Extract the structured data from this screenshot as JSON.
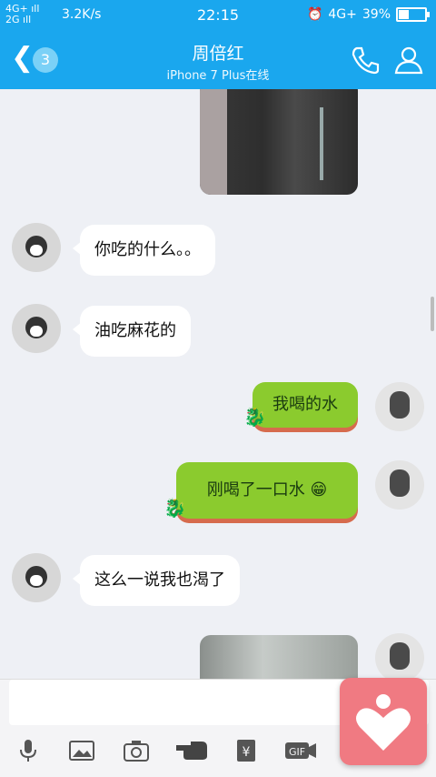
{
  "status_bar": {
    "signal_top": "4G+",
    "signal_bottom": "2G",
    "net_speed": "3.2K/s",
    "time": "22:15",
    "network": "4G+",
    "battery_percent": "39%",
    "battery_level": 0.39
  },
  "title_bar": {
    "back_count": "3",
    "contact_name": "周倍红",
    "device_status": "iPhone 7 Plus在线"
  },
  "messages": [
    {
      "side": "left",
      "type": "text",
      "text": "你吃的什么。。"
    },
    {
      "side": "left",
      "type": "text",
      "text": "油吃麻花的"
    },
    {
      "side": "right",
      "type": "sticker_text",
      "text": "我喝的水"
    },
    {
      "side": "right",
      "type": "sticker_text",
      "text": "刚喝了一口水"
    },
    {
      "side": "left",
      "type": "text",
      "text": "这么一说我也渴了"
    }
  ],
  "input": {
    "placeholder": ""
  },
  "toolbar": {
    "items": [
      "mic-icon",
      "image-icon",
      "camera-icon",
      "hand-icon",
      "red-packet-icon",
      "gif-icon"
    ],
    "gif_label": "GIF",
    "yen_label": "¥"
  },
  "colors": {
    "accent": "#1aa7ee",
    "bubble_green": "#8bcb2e",
    "fab": "#f07a82"
  }
}
